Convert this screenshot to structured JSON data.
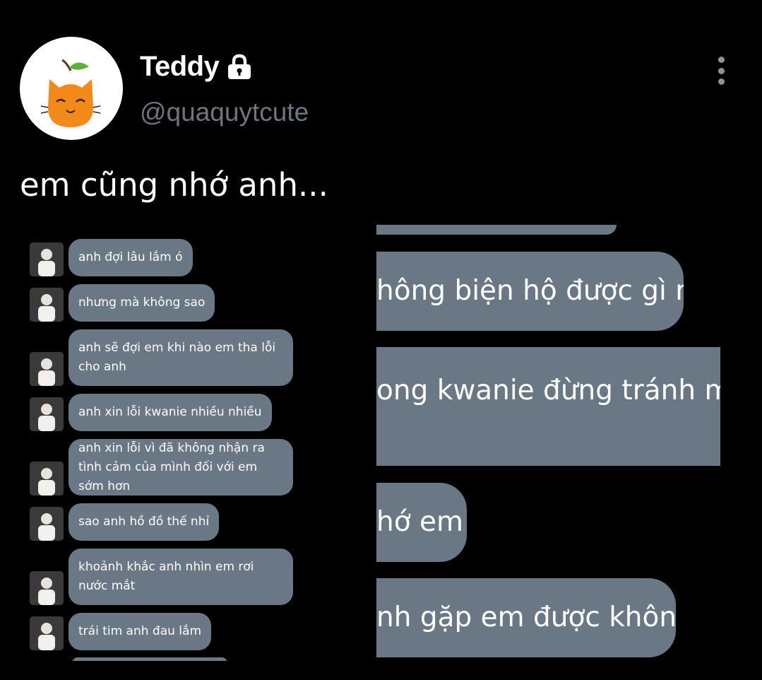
{
  "author": {
    "display_name": "Teddy",
    "handle": "@quaquytcute",
    "locked_icon": "lock-icon",
    "avatar_icon": "orange-cat-icon"
  },
  "menu_icon": "more-vertical-icon",
  "tweet": {
    "text": "em cũng nhớ anh..."
  },
  "chat_left": {
    "messages": [
      "anh đợi lâu lắm ó",
      "nhưng mà không sao",
      "anh sẽ đợi em khi nào em tha lỗi cho anh",
      "anh xin lỗi kwanie nhiều nhiều",
      "anh xin lỗi vì đã không nhận ra tình cảm của mình đối với em sớm hơn",
      "sao anh hồ đồ thế nhỉ",
      "khoảnh khắc anh nhìn em rơi nước mắt",
      "trái tim anh đau lắm"
    ]
  },
  "chat_right": {
    "messages": [
      "hông biện hộ được gì nữa",
      "ong kwanie đừng tránh mặt",
      "hớ em",
      "nh gặp em được không..."
    ]
  },
  "colors": {
    "background": "#000000",
    "bubble": "#6a7785",
    "handle": "#6e767d"
  }
}
